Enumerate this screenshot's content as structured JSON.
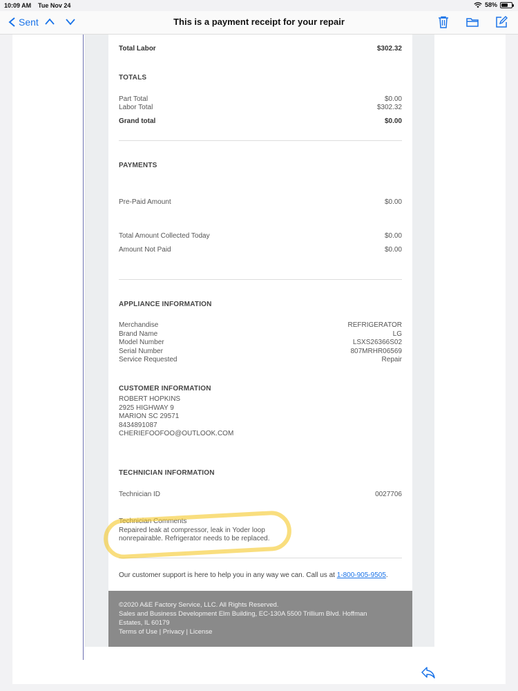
{
  "status": {
    "time": "10:09 AM",
    "date": "Tue Nov 24",
    "battery": "58%",
    "battery_level": 0.58
  },
  "nav": {
    "back_label": "Sent",
    "title": "This is a payment receipt for your repair"
  },
  "labor": {
    "label": "Total Labor",
    "value": "$302.32"
  },
  "totals": {
    "heading": "TOTALS",
    "part_total_label": "Part Total",
    "part_total": "$0.00",
    "labor_total_label": "Labor Total",
    "labor_total": "$302.32",
    "grand_total_label": "Grand total",
    "grand_total": "$0.00"
  },
  "payments": {
    "heading": "PAYMENTS",
    "prepaid_label": "Pre-Paid Amount",
    "prepaid": "$0.00",
    "collected_label": "Total Amount Collected Today",
    "collected": "$0.00",
    "not_paid_label": "Amount Not Paid",
    "not_paid": "$0.00"
  },
  "appliance": {
    "heading": "APPLIANCE INFORMATION",
    "rows": [
      {
        "label": "Merchandise",
        "value": "REFRIGERATOR"
      },
      {
        "label": "Brand Name",
        "value": "LG"
      },
      {
        "label": "Model Number",
        "value": "LSXS26366S02"
      },
      {
        "label": "Serial Number",
        "value": "807MRHR06569"
      },
      {
        "label": "Service Requested",
        "value": "Repair"
      }
    ]
  },
  "customer": {
    "heading": "CUSTOMER INFORMATION",
    "name": "ROBERT HOPKINS",
    "address1": "2925 HIGHWAY 9",
    "address2": "MARION SC 29571",
    "phone": "8434891087",
    "email": "CHERIEFOOFOO@OUTLOOK.COM"
  },
  "technician": {
    "heading": "TECHNICIAN INFORMATION",
    "id_label": "Technician ID",
    "id": "0027706",
    "comments_label": "Technician Comments",
    "comments_line1": "Repaired leak at compressor, leak in Yoder loop",
    "comments_line2": "nonrepairable. Refrigerator needs to be replaced."
  },
  "support": {
    "text": "Our customer support is here to help you in any way we can. Call us at",
    "phone": "1-800-905-9505",
    "suffix": "."
  },
  "footer": {
    "copyright": "©2020 A&E Factory Service, LLC. All Rights Reserved.",
    "address1": "Sales and Business Development Elm Building, EC-130A 5500 Trillium Blvd. Hoffman",
    "address2": "Estates, IL 60179",
    "terms": "Terms of Use",
    "privacy": "Privacy",
    "license": "License",
    "separator": " | "
  },
  "colors": {
    "accent": "#1a73e8",
    "highlight": "#f5c828",
    "footer_bg": "#8a8a8a"
  },
  "icons": [
    "wifi-icon",
    "battery-icon",
    "chevron-left-icon",
    "chevron-up-icon",
    "chevron-down-icon",
    "trash-icon",
    "folder-icon",
    "compose-icon",
    "reply-icon"
  ]
}
